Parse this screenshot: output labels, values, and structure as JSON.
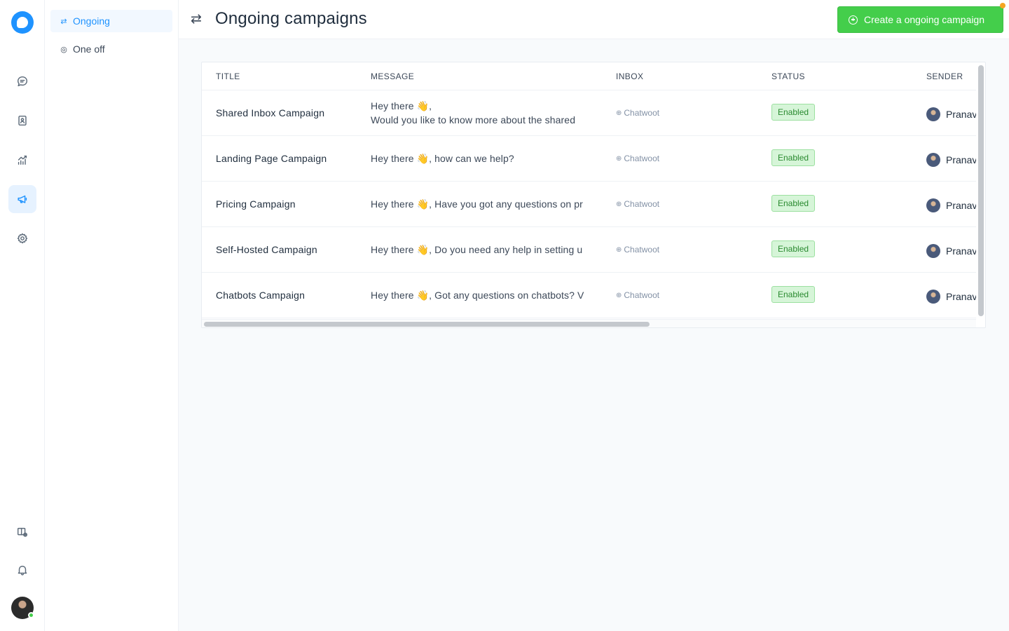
{
  "sidebar": {
    "logo": "chatwoot-logo-icon",
    "icons": [
      "conversations-icon",
      "contacts-icon",
      "reports-icon",
      "campaigns-icon",
      "settings-icon",
      "help-center-icon",
      "notifications-icon"
    ]
  },
  "subnav": {
    "items": [
      {
        "label": "Ongoing",
        "icon": "switch-icon",
        "active": true
      },
      {
        "label": "One off",
        "icon": "broadcast-icon",
        "active": false
      }
    ]
  },
  "header": {
    "title": "Ongoing campaigns",
    "create_label": "Create a ongoing campaign"
  },
  "table": {
    "columns": [
      "TITLE",
      "MESSAGE",
      "INBOX",
      "STATUS",
      "SENDER"
    ],
    "rows": [
      {
        "title": "Shared Inbox Campaign",
        "message_line1": "Hey there 👋,",
        "message_line2": "Would you like to know more about the shared",
        "inbox": "Chatwoot",
        "status": "Enabled",
        "sender": "Pranav"
      },
      {
        "title": "Landing Page Campaign",
        "message_line1": "Hey there 👋, how can we help?",
        "message_line2": "",
        "inbox": "Chatwoot",
        "status": "Enabled",
        "sender": "Pranav"
      },
      {
        "title": "Pricing Campaign",
        "message_line1": "Hey there 👋, Have you got any questions on pr",
        "message_line2": "",
        "inbox": "Chatwoot",
        "status": "Enabled",
        "sender": "Pranav"
      },
      {
        "title": "Self-Hosted Campaign",
        "message_line1": "Hey there 👋, Do you need any help in setting u",
        "message_line2": "",
        "inbox": "Chatwoot",
        "status": "Enabled",
        "sender": "Pranav"
      },
      {
        "title": "Chatbots Campaign",
        "message_line1": "Hey there 👋, Got any questions on chatbots? V",
        "message_line2": "",
        "inbox": "Chatwoot",
        "status": "Enabled",
        "sender": "Pranav"
      }
    ]
  },
  "colors": {
    "accent": "#1f93ff",
    "success": "#44ce4b",
    "badge_bg": "#d6f5d8"
  }
}
